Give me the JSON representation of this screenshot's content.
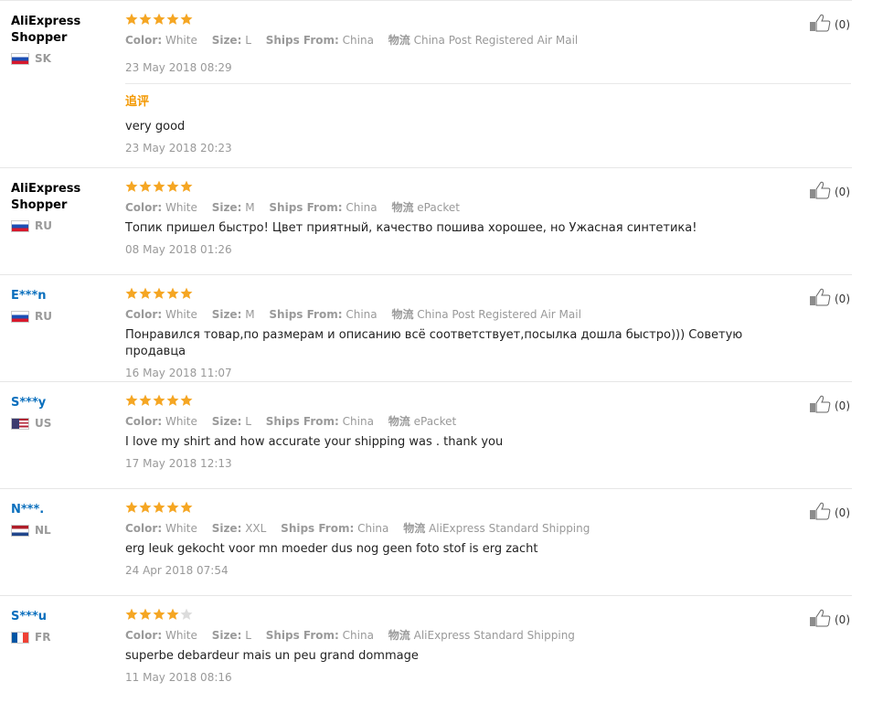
{
  "review_labels": {
    "color": "Color:",
    "size": "Size:",
    "ships_from": "Ships From:",
    "logistics": "物流",
    "append_title": "追评"
  },
  "colors": {
    "star": "#f5a623",
    "star_empty": "#dcdcdc",
    "link_name": "#0a6fbd",
    "append_title": "#f39800"
  },
  "reviews": [
    {
      "name": "AliExpress Shopper",
      "country": "SK",
      "flag": "flag-sk-icon",
      "rating": 5,
      "color": "White",
      "size": "L",
      "ships_from": "China",
      "logistics": "China Post Registered Air Mail",
      "text": "",
      "date": "23 May 2018 08:29",
      "append": {
        "text": "very good",
        "date": "23 May 2018 20:23"
      },
      "helpful": "(0)"
    },
    {
      "name": "AliExpress Shopper",
      "country": "RU",
      "flag": "flag-ru-icon",
      "rating": 5,
      "color": "White",
      "size": "M",
      "ships_from": "China",
      "logistics": "ePacket",
      "text": "Топик пришел быстро! Цвет приятный, качество пошива хорошее, но Ужасная синтетика!",
      "date": "08 May 2018 01:26",
      "helpful": "(0)"
    },
    {
      "name": "E***n",
      "country": "RU",
      "flag": "flag-ru-icon",
      "rating": 5,
      "color": "White",
      "size": "M",
      "ships_from": "China",
      "logistics": "China Post Registered Air Mail",
      "text": "Понравился товар,по размерам и описанию всё соответствует,посылка дошла быстро))) Советую продавца",
      "date": "16 May 2018 11:07",
      "helpful": "(0)"
    },
    {
      "name": "S***y",
      "country": "US",
      "flag": "flag-us-icon",
      "rating": 5,
      "color": "White",
      "size": "L",
      "ships_from": "China",
      "logistics": "ePacket",
      "text": "I love my shirt and how accurate your shipping was . thank you",
      "date": "17 May 2018 12:13",
      "helpful": "(0)"
    },
    {
      "name": "N***.",
      "country": "NL",
      "flag": "flag-nl-icon",
      "rating": 5,
      "color": "White",
      "size": "XXL",
      "ships_from": "China",
      "logistics": "AliExpress Standard Shipping",
      "text": "erg leuk gekocht voor mn moeder dus nog geen foto stof is erg zacht",
      "date": "24 Apr 2018 07:54",
      "helpful": "(0)"
    },
    {
      "name": "S***u",
      "country": "FR",
      "flag": "flag-fr-icon",
      "rating": 4,
      "color": "White",
      "size": "L",
      "ships_from": "China",
      "logistics": "AliExpress Standard Shipping",
      "text": "superbe debardeur mais un peu grand dommage",
      "date": "11 May 2018 08:16",
      "helpful": "(0)"
    }
  ]
}
